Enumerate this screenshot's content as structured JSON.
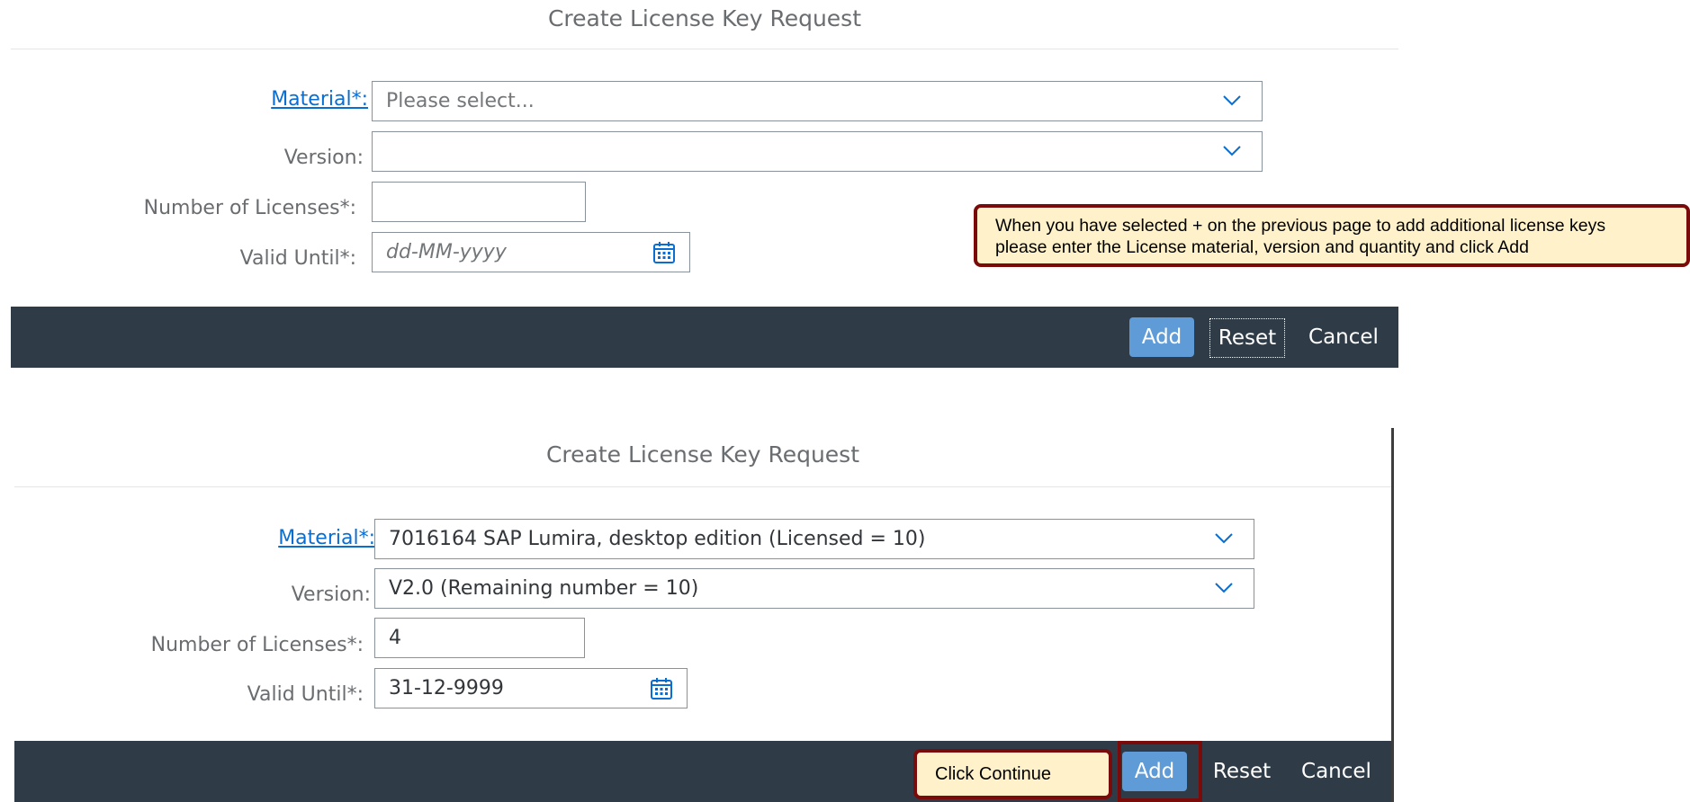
{
  "dialog_1": {
    "title": "Create License Key Request",
    "material_label": "Material*:",
    "material_placeholder": "Please select...",
    "version_label": "Version:",
    "version_value": "",
    "licenses_label": "Number of Licenses*:",
    "licenses_value": "",
    "valid_until_label": "Valid Until*:",
    "valid_until_placeholder": "dd-MM-yyyy",
    "buttons": {
      "add": "Add",
      "reset": "Reset",
      "cancel": "Cancel"
    }
  },
  "dialog_2": {
    "title": "Create License Key Request",
    "material_label": "Material*:",
    "material_value": "7016164 SAP Lumira, desktop edition (Licensed = 10)",
    "version_label": "Version:",
    "version_value": "V2.0 (Remaining number = 10)",
    "licenses_label": "Number of Licenses*:",
    "licenses_value": "4",
    "valid_until_label": "Valid Until*:",
    "valid_until_value": "31-12-9999",
    "buttons": {
      "add": "Add",
      "reset": "Reset",
      "cancel": "Cancel"
    }
  },
  "callouts": {
    "instruction_line_1": "When you have selected + on the previous page to add additional license keys",
    "instruction_line_2": "please enter the License material, version and quantity and click Add",
    "click_continue": "Click Continue"
  },
  "icons": {
    "dropdown": "chevron-down-icon",
    "date_picker": "calendar-icon"
  },
  "colors": {
    "link": "#0a6ed1",
    "footer": "#2f3c48",
    "primary_button": "#5f9bd6",
    "callout_fill": "#fff1c9",
    "callout_border": "#7a0b0b"
  }
}
